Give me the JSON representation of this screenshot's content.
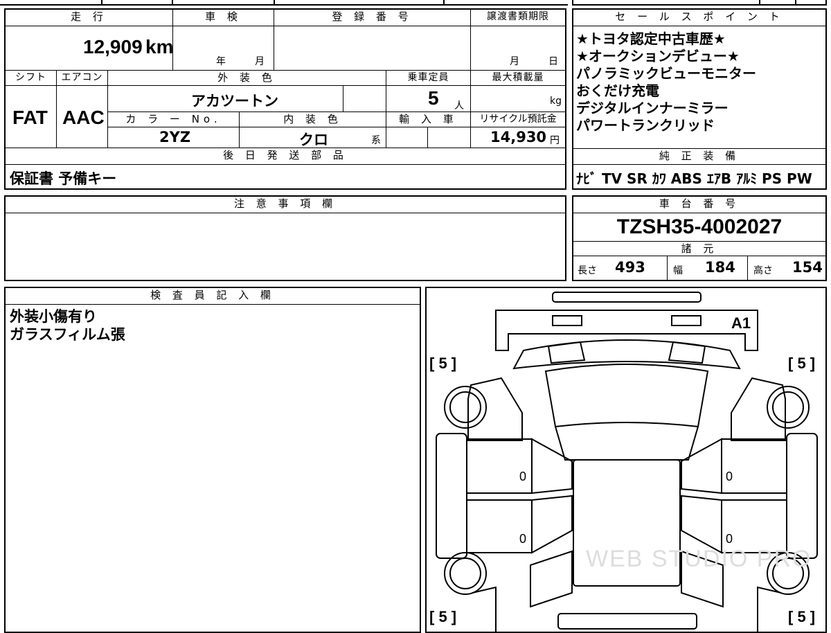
{
  "sheet": {
    "mileage_header": "走 行",
    "inspection_header": "車 検",
    "reg_no_header": "登 録 番 号",
    "transfer_header": "譲渡書類期限",
    "mileage_value": "12,909",
    "mileage_unit": "km",
    "inspection_year": "年",
    "inspection_month": "月",
    "transfer_month": "月",
    "transfer_day": "日",
    "shift_header": "シフト",
    "aircon_header": "エアコン",
    "ext_color_header": "外 装 色",
    "seats_header": "乗車定員",
    "load_header": "最大積載量",
    "shift_value": "FAT",
    "aircon_value": "AAC",
    "ext_color_value": "アカツートン",
    "seats_value": "5",
    "seats_unit": "人",
    "load_unit": "kg",
    "color_no_header": "カ ラ ー No.",
    "int_color_header": "内 装 色",
    "import_header": "輸 入 車",
    "recycle_header": "リサイクル預託金",
    "color_no_value": "2YZ",
    "int_color_value": "クロ",
    "int_color_suffix": "系",
    "recycle_value": "14,930",
    "recycle_unit": "円",
    "parts_header": "後 日 発 送 部 品",
    "parts_value": "保証書  予備キー",
    "notes_header": "注 意 事 項 欄",
    "inspector_header": "検 査 員 記 入 欄",
    "inspector_lines": [
      "外装小傷有り",
      "ガラスフィルム張"
    ]
  },
  "sales": {
    "header": "セ ー ル ス ポ イ ン ト",
    "points": [
      "★トヨタ認定中古車歴★",
      "★オークションデビュー★",
      "パノラミックビューモニター",
      "おくだけ充電",
      "デジタルインナーミラー",
      "パワートランクリッド"
    ]
  },
  "equipment": {
    "header": "純 正 装 備",
    "value": "ﾅﾋﾞ TV SR ｶﾜ ABS ｴｱB ｱﾙﾐ PS PW"
  },
  "chassis": {
    "header": "車 台 番 号",
    "value": "TZSH35-4002027"
  },
  "specs": {
    "header": "諸 元",
    "length_label": "長さ",
    "length_value": "493",
    "width_label": "幅",
    "width_value": "184",
    "height_label": "高さ",
    "height_value": "154"
  },
  "diagram": {
    "mark": "A1",
    "tire_fl": "[ 5 ]",
    "tire_fr": "[ 5 ]",
    "tire_rl": "[ 5 ]",
    "tire_rr": "[ 5 ]",
    "door_lf": "0",
    "door_lr": "0",
    "door_rf": "0",
    "door_rr": "0",
    "watermark": "WEB STUDIO PRO"
  }
}
